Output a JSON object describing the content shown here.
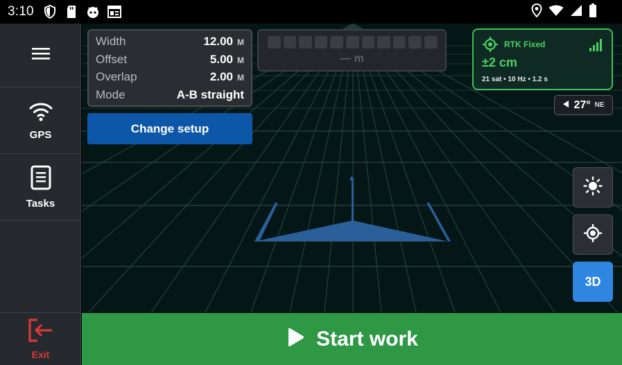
{
  "statusbar": {
    "time": "3:10",
    "left_icons": [
      "shield-icon",
      "sd-card-icon",
      "android-face-icon",
      "news-icon"
    ],
    "right_icons": [
      "location-pin-icon",
      "wifi-icon",
      "cell-signal-icon",
      "battery-icon"
    ]
  },
  "sidebar": {
    "menu_icon": "hamburger-icon",
    "gps_label": "GPS",
    "tasks_label": "Tasks",
    "exit_label": "Exit"
  },
  "setup": {
    "rows": [
      {
        "key": "Width",
        "value": "12.00",
        "unit": "M"
      },
      {
        "key": "Offset",
        "value": "5.00",
        "unit": "M"
      },
      {
        "key": "Overlap",
        "value": "2.00",
        "unit": "M"
      },
      {
        "key": "Mode",
        "value": "A-B straight",
        "unit": ""
      }
    ],
    "change_label": "Change setup"
  },
  "lightbar": {
    "led_count": 11,
    "distance": "— m"
  },
  "rtk": {
    "status": "RTK Fixed",
    "accuracy": "±2 cm",
    "details": "21 sat • 10 Hz • 1.2 s",
    "color": "#4cd063"
  },
  "heading": {
    "degrees": "27°",
    "direction": "NE"
  },
  "view": {
    "mode_label": "3D"
  },
  "start": {
    "label": "Start work",
    "color": "#2e9845"
  },
  "colors": {
    "accent_blue": "#0d57a8",
    "toggle_blue": "#2f86e0",
    "exit_red": "#d8393b",
    "vehicle_blue": "#2a5f9a"
  }
}
